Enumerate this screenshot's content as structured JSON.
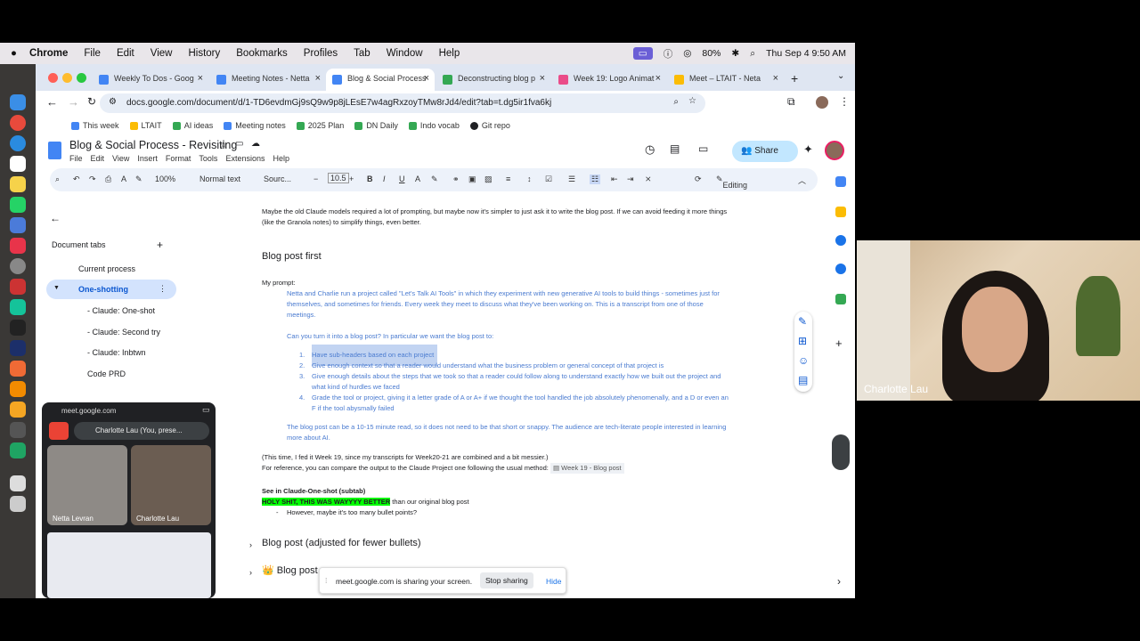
{
  "menubar": {
    "app": "Chrome",
    "items": [
      "File",
      "Edit",
      "View",
      "History",
      "Bookmarks",
      "Profiles",
      "Tab",
      "Window",
      "Help"
    ],
    "battery": "80%",
    "datetime": "Thu Sep 4  9:50 AM"
  },
  "tabs": [
    {
      "label": "Weekly To Dos - Goog",
      "color": "#4285f4"
    },
    {
      "label": "Meeting Notes - Netta",
      "color": "#4285f4"
    },
    {
      "label": "Blog & Social Process",
      "color": "#4285f4",
      "active": true
    },
    {
      "label": "Deconstructing blog p",
      "color": "#34a853"
    },
    {
      "label": "Week 19: Logo Animat",
      "color": "#ea4c89"
    },
    {
      "label": "Meet – LTAIT - Neta",
      "color": "#fbbc04"
    }
  ],
  "url": "docs.google.com/document/d/1-TD6evdmGj9sQ9w9p8jLEsE7w4agRxzoyTMw8rJd4/edit?tab=t.dg5ir1fva6kj",
  "bookmarks": [
    {
      "label": "This week",
      "color": "#4285f4"
    },
    {
      "label": "LTAIT",
      "color": "#fbbc04"
    },
    {
      "label": "AI ideas",
      "color": "#34a853"
    },
    {
      "label": "Meeting notes",
      "color": "#4285f4"
    },
    {
      "label": "2025 Plan",
      "color": "#34a853"
    },
    {
      "label": "DN Daily",
      "color": "#34a853"
    },
    {
      "label": "Indo vocab",
      "color": "#34a853"
    },
    {
      "label": "Git repo",
      "color": "#202124"
    }
  ],
  "doc": {
    "title": "Blog & Social Process - Revisiting",
    "menus": [
      "File",
      "Edit",
      "View",
      "Insert",
      "Format",
      "Tools",
      "Extensions",
      "Help"
    ],
    "share": "Share"
  },
  "toolbar": {
    "zoom": "100%",
    "style": "Normal text",
    "font": "Sourc...",
    "size": "10.5",
    "mode": "Editing"
  },
  "sidebar": {
    "header": "Document tabs",
    "items": [
      "Current process",
      "One-shotting",
      "- Claude: One-shot",
      "- Claude: Second try",
      "- Claude: Inbtwn",
      "Code PRD"
    ]
  },
  "body": {
    "l1": "Maybe the old Claude models required a lot of prompting, but maybe now it's simpler to just ask it to write the blog post. If we can avoid feeding it more things",
    "l2": "(like the Granola notes) to simplify things, even better.",
    "h1": "Blog post first",
    "prompt": "My prompt:",
    "p1": "Netta and Charlie run a project called \"Let's Talk AI Tools\" in which they experiment with new generative AI tools to build things - sometimes just for",
    "p2": "themselves, and sometimes for friends. Every week they meet to discuss what they've been working on. This is a transcript from one of those",
    "p3": "meetings.",
    "p4": "Can you turn it into a blog post? In particular we want the blog post to:",
    "li1": "Have sub-headers based on each project",
    "li2": "Give enough context so that a reader would understand what the business problem or general concept of that project is",
    "li3a": "Give enough details about the steps that we took so that a reader could follow along to understand exactly how we built out the project and",
    "li3b": "what kind of hurdles we faced",
    "li4a": "Grade the tool or project, giving it a letter grade of A or A+ if we thought the tool handled the job absolutely phenomenally, and a D or even an",
    "li4b": "F if the tool abysmally failed",
    "p5": "The blog post can be a 10-15 minute read, so it does not need to be that short or snappy. The audience are tech-literate people interested in learning",
    "p6": "more about AI.",
    "n1": "(This time, I fed it Week 19, since my transcripts for Week20-21 are combined and a bit messier.)",
    "n2": "For reference, you can compare the output to the Claude Project one following the usual method:",
    "chip": "Week 19 - Blog post",
    "see": "See in Claude-One-shot (subtab)",
    "holy": "HOLY SHIT, THIS WAS WAYYYY BETTER",
    "holy2": " than our original blog post",
    "bullet": "However, maybe it's too many bullet points?",
    "h2": "Blog post (adjusted for fewer bullets)",
    "h3": "Blog post"
  },
  "meet": {
    "host": "meet.google.com",
    "presenter": "Charlotte Lau (You, prese...",
    "p1": "Netta Levran",
    "p2": "Charlotte Lau"
  },
  "banner": {
    "text": "meet.google.com is sharing your screen.",
    "stop": "Stop sharing",
    "hide": "Hide"
  },
  "camera": {
    "name": "Charlotte Lau"
  }
}
